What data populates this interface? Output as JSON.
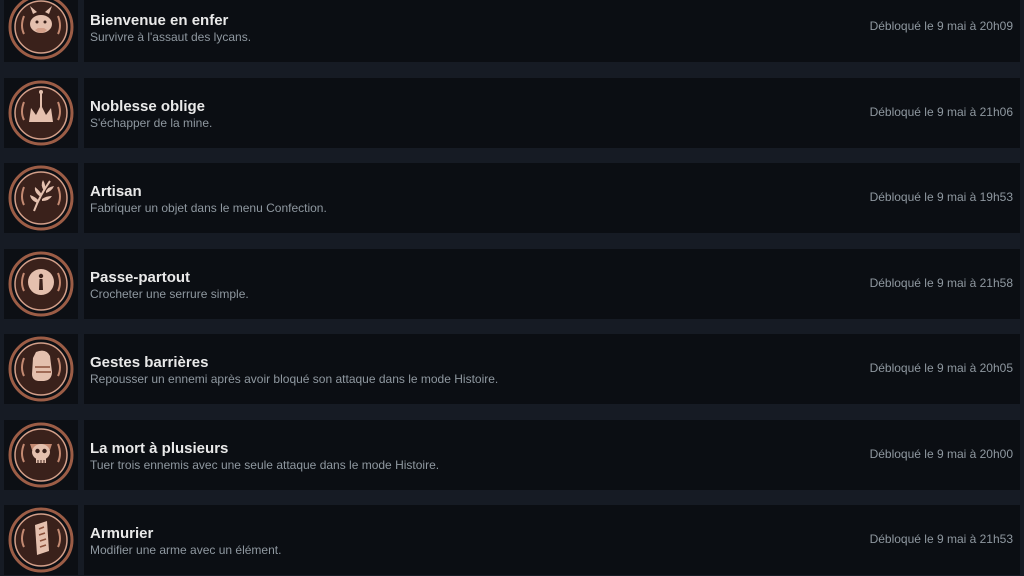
{
  "achievements": [
    {
      "title": "Bienvenue en enfer",
      "description": "Survivre à l'assaut des lycans.",
      "unlocked": "Débloqué le 9 mai à 20h09",
      "icon": "boar-head-icon"
    },
    {
      "title": "Noblesse oblige",
      "description": "S'échapper de la mine.",
      "unlocked": "Débloqué le 9 mai à 21h06",
      "icon": "crown-icon"
    },
    {
      "title": "Artisan",
      "description": "Fabriquer un objet dans le menu Confection.",
      "unlocked": "Débloqué le 9 mai à 19h53",
      "icon": "herb-icon"
    },
    {
      "title": "Passe-partout",
      "description": "Crocheter une serrure simple.",
      "unlocked": "Débloqué le 9 mai à 21h58",
      "icon": "keyhole-icon"
    },
    {
      "title": "Gestes barrières",
      "description": "Repousser un ennemi après avoir bloqué son attaque dans le mode Histoire.",
      "unlocked": "Débloqué le 9 mai à 20h05",
      "icon": "boot-icon"
    },
    {
      "title": "La mort à plusieurs",
      "description": "Tuer trois ennemis avec une seule attaque dans le mode Histoire.",
      "unlocked": "Débloqué le 9 mai à 20h00",
      "icon": "skull-icon"
    },
    {
      "title": "Armurier",
      "description": "Modifier une arme avec un élément.",
      "unlocked": "Débloqué le 9 mai à 21h53",
      "icon": "blade-icon"
    }
  ],
  "colors": {
    "background": "#161b24",
    "panel": "#0b0e13",
    "title": "#e9e9e9",
    "text": "#8f98a0",
    "badge_bronze": "#8a4f3a"
  }
}
